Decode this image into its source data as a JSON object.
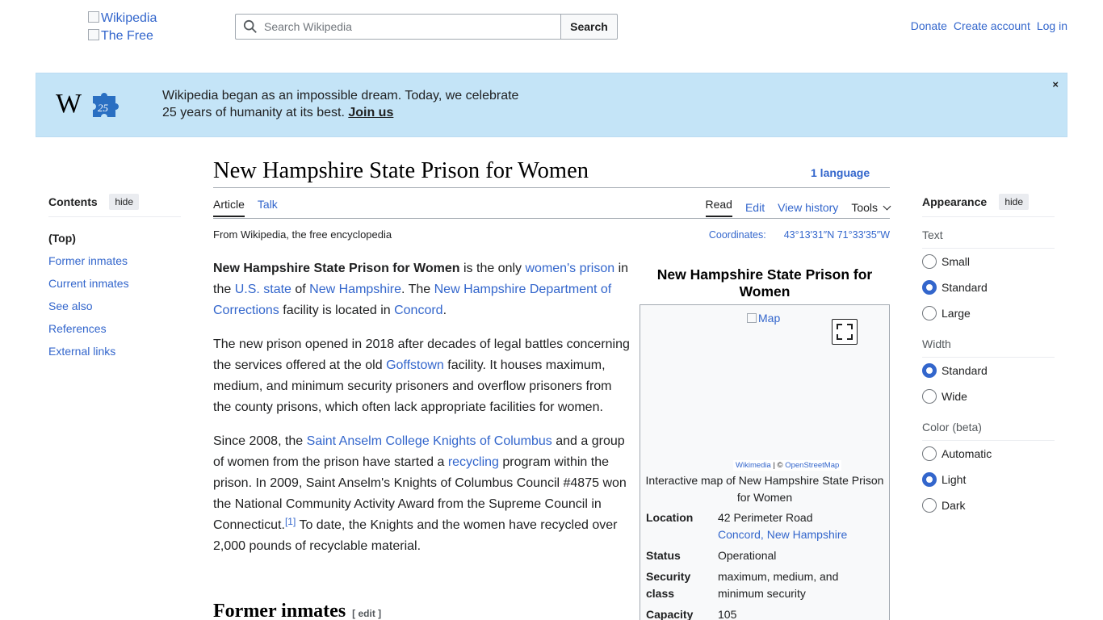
{
  "header": {
    "logo_alt_1": "Wikipedia",
    "logo_alt_2": "The Free",
    "search_placeholder": "Search Wikipedia",
    "search_button": "Search",
    "user_links": [
      "Donate",
      "Create account",
      "Log in"
    ]
  },
  "banner": {
    "line1": "Wikipedia began as an impossible dream. Today, we celebrate",
    "line2": "25 years of humanity at its best.",
    "link": "Join us",
    "close": "×",
    "logo_letter": "W",
    "logo_number": "25"
  },
  "toc": {
    "title": "Contents",
    "hide": "hide",
    "items": [
      "(Top)",
      "Former inmates",
      "Current inmates",
      "See also",
      "References",
      "External links"
    ]
  },
  "article": {
    "title": "New Hampshire State Prison for Women",
    "language": "1 language",
    "tabs_left": [
      "Article",
      "Talk"
    ],
    "tabs_right": [
      "Read",
      "Edit",
      "View history"
    ],
    "tools": "Tools",
    "from": "From Wikipedia, the free encyclopedia",
    "coords_label": "Coordinates:",
    "coords_value": "43°13′31″N 71°33′35″W",
    "p1": {
      "bold": "New Hampshire State Prison for Women",
      "t1": " is the only ",
      "l1": "women's prison",
      "t2": " in the ",
      "l2": "U.S. state",
      "t3": " of ",
      "l3": "New Hampshire",
      "t4": ". The ",
      "l4": "New Hampshire Department of Corrections",
      "t5": " facility is located in ",
      "l5": "Concord",
      "t6": "."
    },
    "p2": {
      "t1": "The new prison opened in 2018 after decades of legal battles concerning the services offered at the old ",
      "l1": "Goffstown",
      "t2": " facility. It houses maximum, medium, and minimum security prisoners and overflow prisoners from the county prisons, which often lack appropriate facilities for women."
    },
    "p3": {
      "t1": "Since 2008, the ",
      "l1": "Saint Anselm College Knights of Columbus",
      "t2": " and a group of women from the prison have started a ",
      "l2": "recycling",
      "t3": " program within the prison. In 2009, Saint Anselm's Knights of Columbus Council #4875 won the National Community Activity Award from the Supreme Council in Connecticut.",
      "ref": "[1]",
      "t4": " To date, the Knights and the women have recycled over 2,000 pounds of recyclable material."
    },
    "h2": "Former inmates",
    "h2_edit": "[ edit ]"
  },
  "infobox": {
    "title": "New Hampshire State Prison for Women",
    "map_alt": "Map",
    "attrib_1": "Wikimedia",
    "attrib_sep": " | © ",
    "attrib_2": "OpenStreetMap",
    "caption": "Interactive map of New Hampshire State Prison for Women",
    "location_label": "Location",
    "location_line1": "42 Perimeter Road",
    "location_link1": "Concord",
    "location_comma": ", ",
    "location_link2": "New Hampshire",
    "status_label": "Status",
    "status_value": "Operational",
    "security_label": "Security class",
    "security_value": "maximum, medium, and minimum security",
    "capacity_label": "Capacity",
    "capacity_value": "105"
  },
  "appearance": {
    "title": "Appearance",
    "hide": "hide",
    "text_label": "Text",
    "text_options": [
      "Small",
      "Standard",
      "Large"
    ],
    "text_selected": "Standard",
    "width_label": "Width",
    "width_options": [
      "Standard",
      "Wide"
    ],
    "width_selected": "Standard",
    "color_label": "Color (beta)",
    "color_options": [
      "Automatic",
      "Light",
      "Dark"
    ],
    "color_selected": "Light"
  },
  "colors": {
    "link": "#3366cc",
    "banner_bg": "#c4e4f7",
    "text": "#202122",
    "border": "#a2a9b1"
  }
}
